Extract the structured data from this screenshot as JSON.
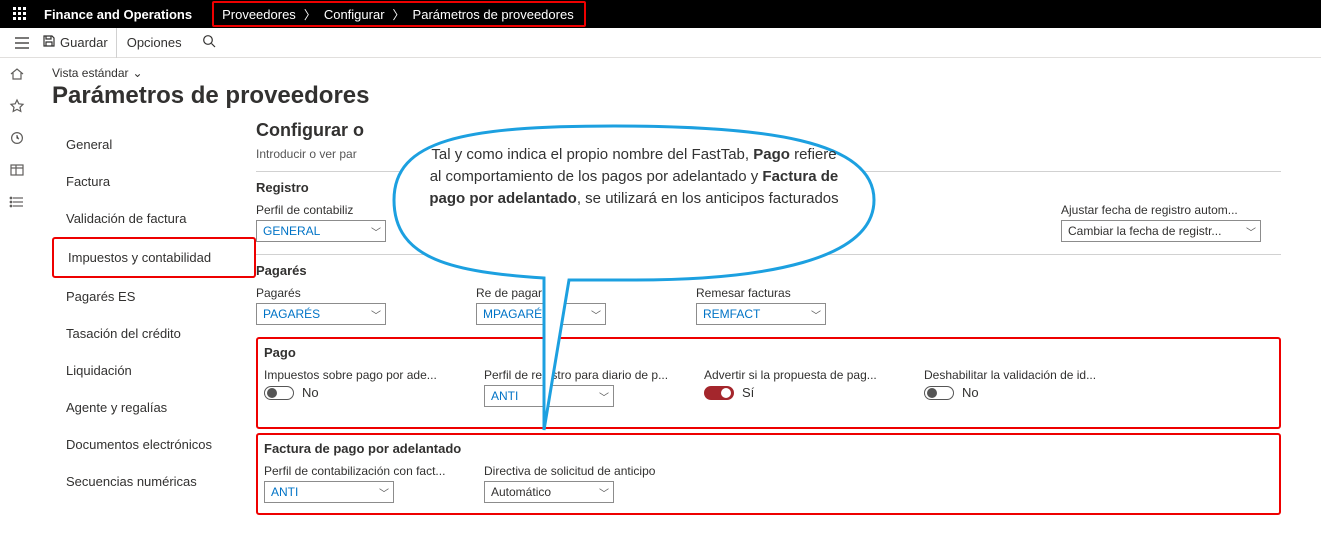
{
  "header": {
    "brand": "Finance and Operations",
    "breadcrumb": [
      "Proveedores",
      "Configurar",
      "Parámetros de proveedores"
    ]
  },
  "toolbar": {
    "save": "Guardar",
    "options": "Opciones"
  },
  "view": {
    "label": "Vista estándar"
  },
  "page_title": "Parámetros de proveedores",
  "sidenav": {
    "items": [
      "General",
      "Factura",
      "Validación de factura",
      "Impuestos y contabilidad",
      "Pagarés ES",
      "Tasación del crédito",
      "Liquidación",
      "Agente y regalías",
      "Documentos electrónicos",
      "Secuencias numéricas"
    ],
    "selected_index": 3
  },
  "form": {
    "section_title": "Configurar o",
    "section_sub": "Introducir o ver par",
    "registro": {
      "head": "Registro",
      "perfilcont_label": "Perfil de contabiliz",
      "perfilcont_value": "GENERAL",
      "ajustar_label": "Ajustar fecha de registro autom...",
      "ajustar_value": "Cambiar la fecha de registr..."
    },
    "pagares": {
      "head": "Pagarés",
      "pagares_label": "Pagarés",
      "pagares_value": "PAGARÉS",
      "remitir_label": "Re          de pagarés",
      "remitir_value": "MPAGARÉ",
      "remesar_label": "Remesar facturas",
      "remesar_value": "REMFACT"
    },
    "pago": {
      "head": "Pago",
      "imp_label": "Impuestos sobre pago por ade...",
      "imp_toggle_text": "No",
      "perfildiario_label": "Perfil de registro para diario de p...",
      "perfildiario_value": "ANTI",
      "advertir_label": "Advertir si la propuesta de pag...",
      "advertir_toggle_text": "Sí",
      "deshab_label": "Deshabilitar la validación de id...",
      "deshab_toggle_text": "No"
    },
    "facturapa": {
      "head": "Factura de pago por adelantado",
      "perfilfact_label": "Perfil de contabilización con fact...",
      "perfilfact_value": "ANTI",
      "directiva_label": "Directiva de solicitud de anticipo",
      "directiva_value": "Automático"
    }
  },
  "callout": {
    "t1": "Tal y como indica el propio nombre del FastTab, ",
    "b1": "Pago",
    "t2": " refiere al comportamiento de los pagos por adelantado y ",
    "b2": "Factura de pago por adelantado",
    "t3": ", se utilizará en los anticipos facturados"
  }
}
